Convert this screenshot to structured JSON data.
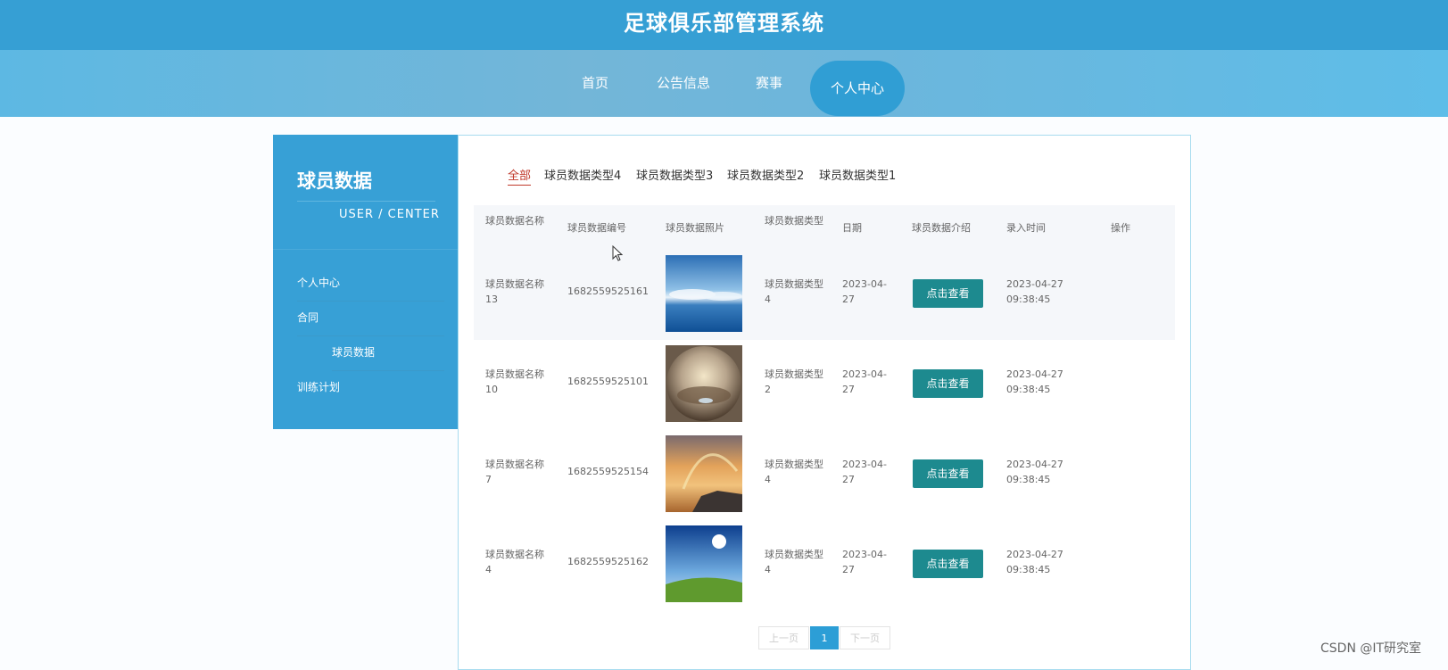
{
  "header": {
    "title": "足球俱乐部管理系统"
  },
  "nav": {
    "items": [
      {
        "label": "首页"
      },
      {
        "label": "公告信息"
      },
      {
        "label": "赛事"
      },
      {
        "label": "个人中心"
      }
    ],
    "active_index": 3
  },
  "sidebar": {
    "title": "球员数据",
    "subtitle": "USER / CENTER",
    "items": [
      {
        "label": "个人中心"
      },
      {
        "label": "合同"
      },
      {
        "label": "球员数据"
      },
      {
        "label": "训练计划"
      }
    ]
  },
  "filters": {
    "items": [
      {
        "label": "全部"
      },
      {
        "label": "球员数据类型4"
      },
      {
        "label": "球员数据类型3"
      },
      {
        "label": "球员数据类型2"
      },
      {
        "label": "球员数据类型1"
      }
    ],
    "active_index": 0
  },
  "table": {
    "headers": {
      "name": "球员数据名称",
      "code": "球员数据编号",
      "photo": "球员数据照片",
      "type": "球员数据类型",
      "date": "日期",
      "intro": "球员数据介绍",
      "time": "录入时间",
      "op": "操作"
    },
    "rows": [
      {
        "name": "球员数据名称13",
        "code": "1682559525161",
        "type": "球员数据类型4",
        "date": "2023-04-27",
        "intro_button": "点击查看",
        "time": "2023-04-27 09:38:45",
        "photo_icon": "sky-ocean-photo"
      },
      {
        "name": "球员数据名称10",
        "code": "1682559525101",
        "type": "球员数据类型2",
        "date": "2023-04-27",
        "intro_button": "点击查看",
        "time": "2023-04-27 09:38:45",
        "photo_icon": "sunset-sphere-photo"
      },
      {
        "name": "球员数据名称7",
        "code": "1682559525154",
        "type": "球员数据类型4",
        "date": "2023-04-27",
        "intro_button": "点击查看",
        "time": "2023-04-27 09:38:45",
        "photo_icon": "rainbow-coast-photo"
      },
      {
        "name": "球员数据名称4",
        "code": "1682559525162",
        "type": "球员数据类型4",
        "date": "2023-04-27",
        "intro_button": "点击查看",
        "time": "2023-04-27 09:38:45",
        "photo_icon": "grass-sky-photo"
      }
    ]
  },
  "pagination": {
    "prev": "上一页",
    "current": "1",
    "next": "下一页"
  },
  "watermark": "CSDN @IT研究室"
}
